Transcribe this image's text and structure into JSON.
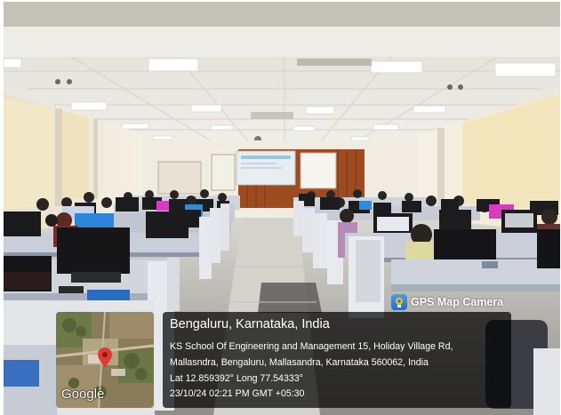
{
  "overlay": {
    "app_name": "GPS Map Camera",
    "location_title": "Bengaluru, Karnataka, India",
    "address_line1": "KS School Of Engineering and Management 15, Holiday Village Rd,",
    "address_line2": "Mallasndra, Bengaluru, Mallasandra, Karnataka 560062, India",
    "coordinates": "Lat 12.859392° Long 77.54333°",
    "timestamp": "23/10/24 02:21 PM GMT +05:30",
    "map_brand": "Google"
  },
  "scene": {
    "subject": "computer-lab",
    "icons": [
      "map-pin-icon",
      "camera-icon"
    ],
    "colors": {
      "ceiling": "#e9e6de",
      "wall": "#efe9dc",
      "floor": "#b5b2aa",
      "wood_panel": "#a14e22",
      "overlay_bg": "#000000",
      "pin": "#e23b2e"
    }
  }
}
